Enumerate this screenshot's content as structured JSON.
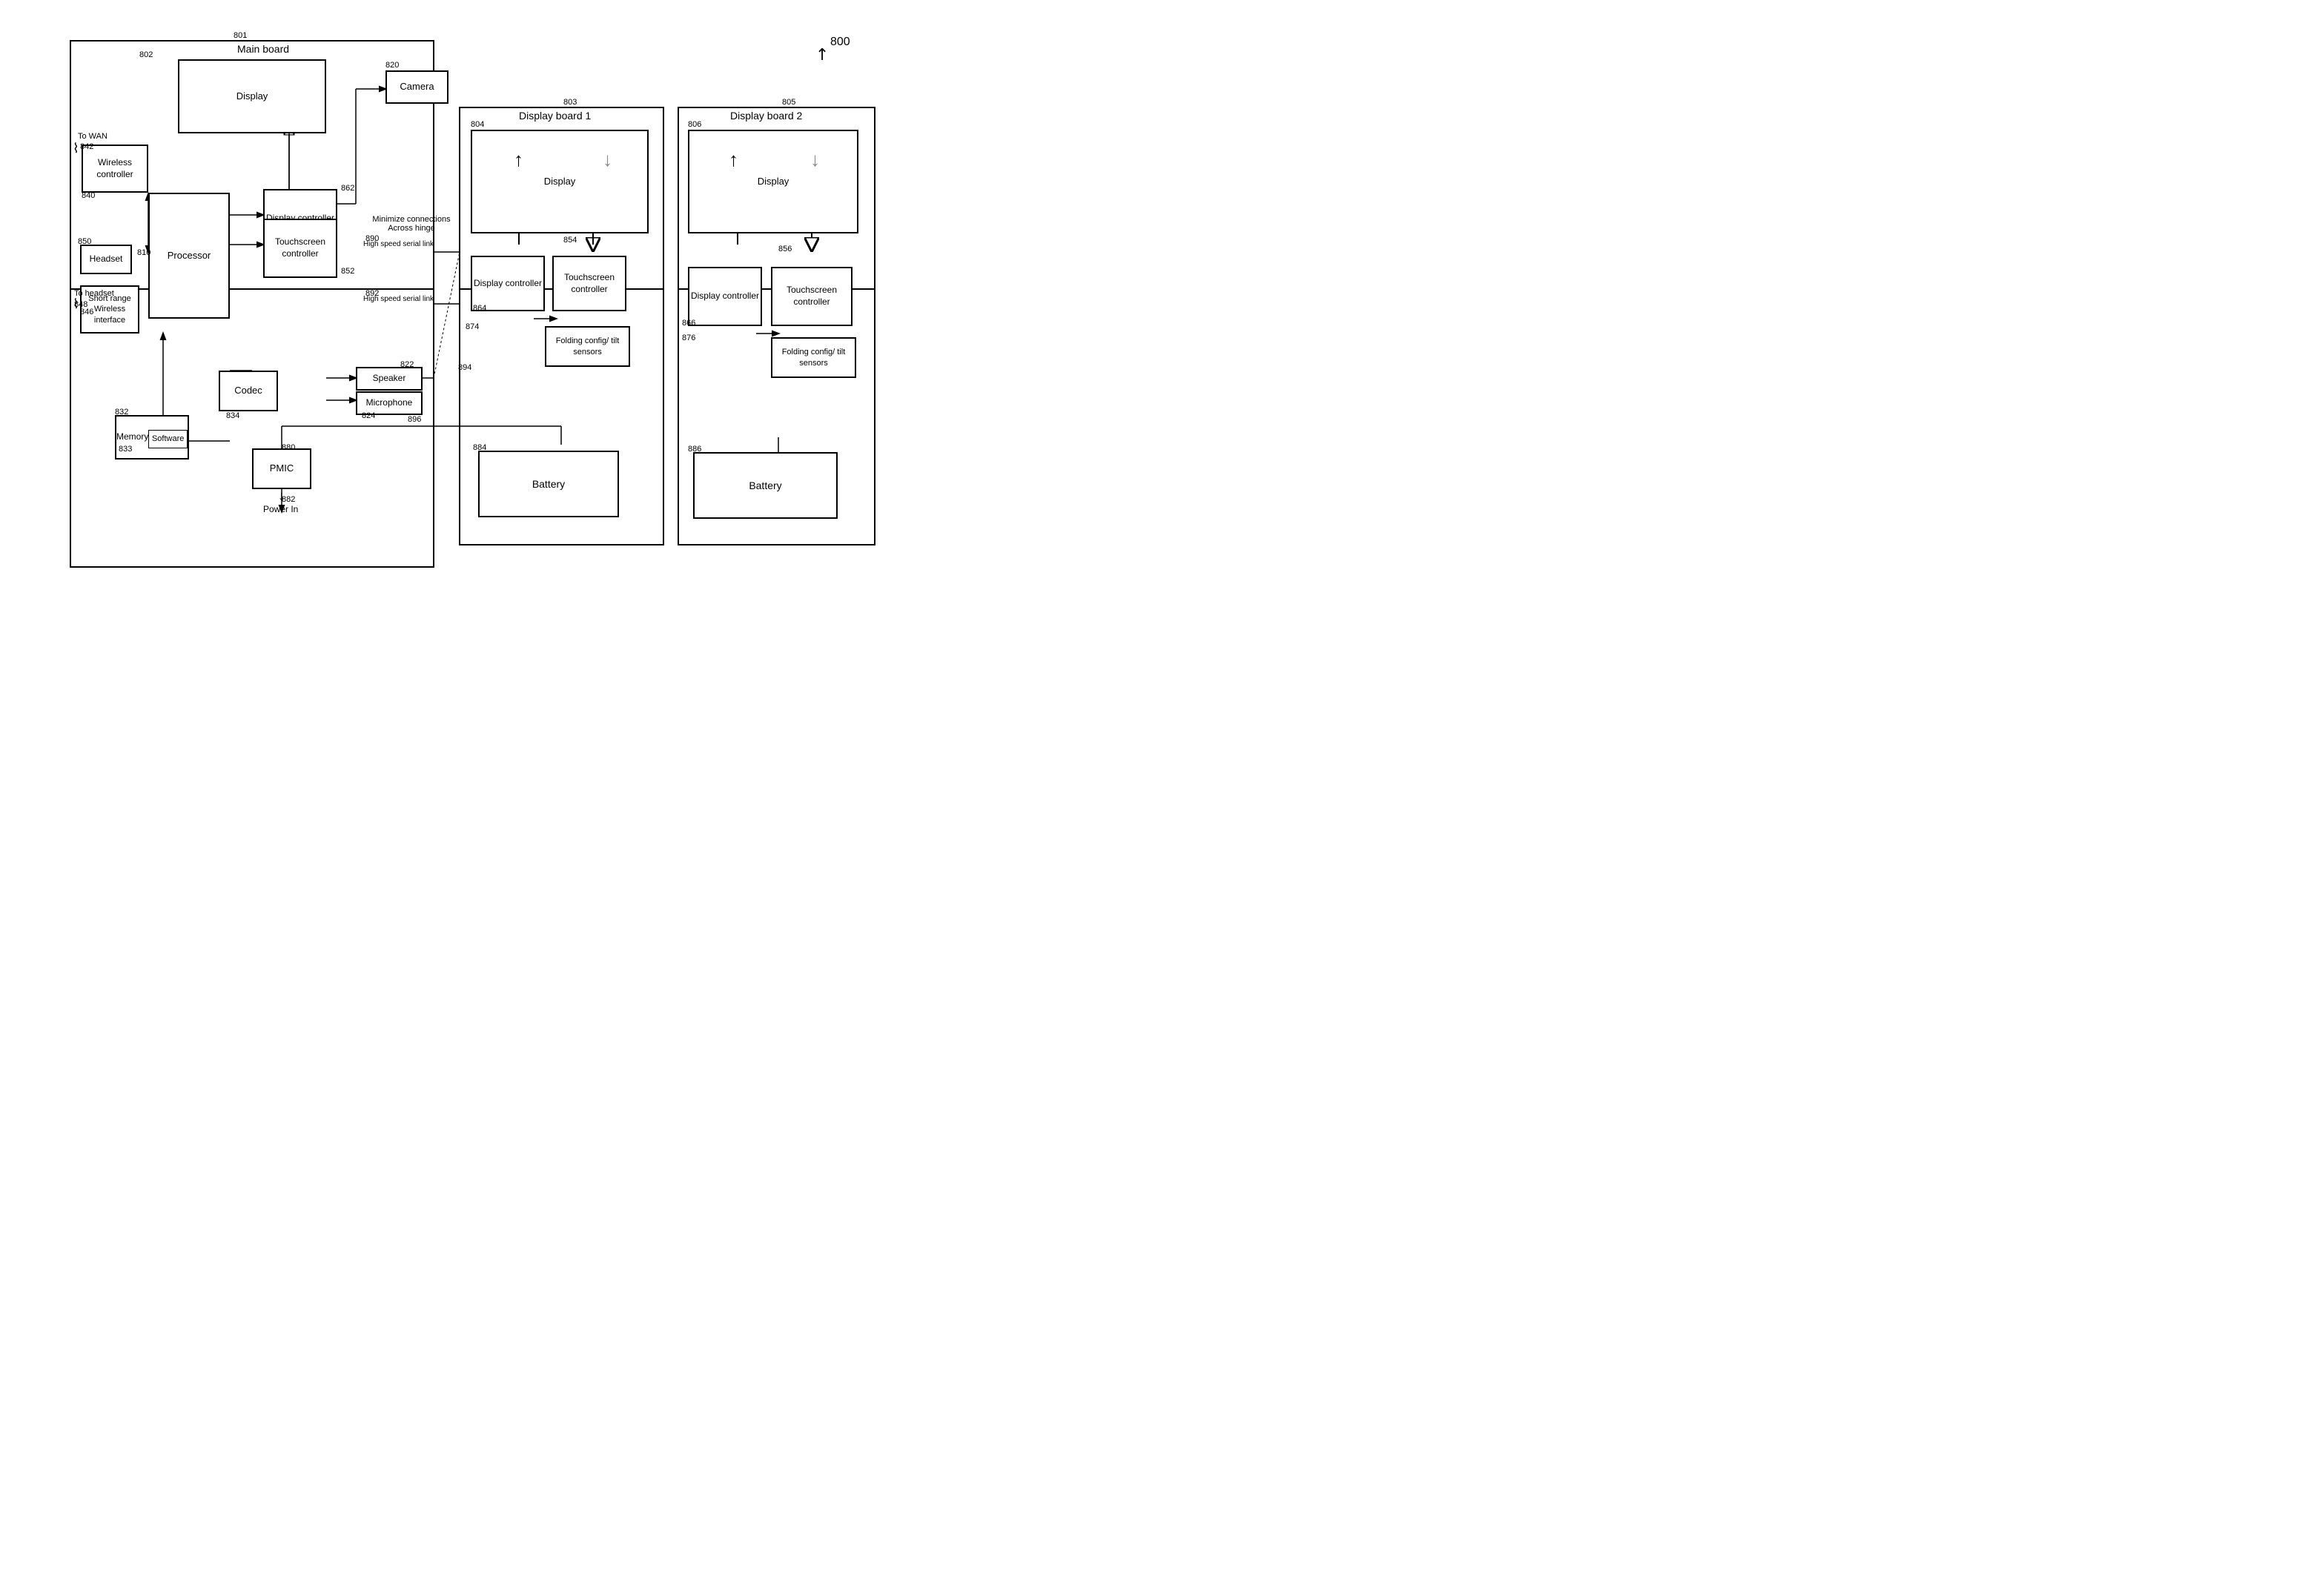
{
  "diagram": {
    "title": "800",
    "ref800": "800",
    "mainBoard": {
      "label": "Main board",
      "ref": "801",
      "display": {
        "label": "Display",
        "ref": "802"
      },
      "displayController": {
        "label": "Display controller",
        "ref": "862"
      },
      "touchscreenController": {
        "label": "Touchscreen controller",
        "ref": "852"
      },
      "processor": {
        "label": "Processor",
        "ref": "810"
      },
      "wirelessController": {
        "label": "Wireless controller",
        "ref": "840"
      },
      "shortRangeWireless": {
        "label": "Short range Wireless interface",
        "ref": "846"
      },
      "headset": {
        "label": "Headset",
        "ref": "850"
      },
      "toWAN": {
        "label": "To WAN",
        "ref": "842"
      },
      "toHeadset": {
        "label": "To headset",
        "ref": "848"
      },
      "memory": {
        "label": "Memory",
        "ref": "832"
      },
      "software": {
        "label": "Software",
        "ref": "833"
      },
      "codec": {
        "label": "Codec",
        "ref": "834"
      },
      "pmic": {
        "label": "PMIC",
        "ref": "880"
      },
      "camera": {
        "label": "Camera",
        "ref": "820"
      },
      "speaker": {
        "label": "Speaker",
        "ref": "822"
      },
      "microphone": {
        "label": "Microphone",
        "ref": "824"
      }
    },
    "displayBoard1": {
      "label": "Display board 1",
      "ref": "803",
      "display": {
        "label": "Display",
        "ref": "804"
      },
      "displayController": {
        "label": "Display controller",
        "ref": "864"
      },
      "touchscreenController": {
        "label": "Touchscreen controller",
        "ref": "854"
      },
      "foldingConfig": {
        "label": "Folding config/ tilt sensors",
        "ref": "874"
      }
    },
    "displayBoard2": {
      "label": "Display board 2",
      "ref": "805",
      "display": {
        "label": "Display",
        "ref": "806"
      },
      "displayController": {
        "label": "Display controller",
        "ref": "866"
      },
      "touchscreenController": {
        "label": "Touchscreen controller",
        "ref": "856"
      },
      "foldingConfig": {
        "label": "Folding config/ tilt sensors",
        "ref": "876"
      }
    },
    "battery1": {
      "label": "Battery",
      "ref": "884"
    },
    "battery2": {
      "label": "Battery",
      "ref": "886"
    },
    "powerIn": {
      "label": "Power In",
      "ref": "882"
    },
    "annotations": {
      "minimizeConnections": "Minimize connections\nAcross hinge",
      "highSpeedSerial1": "High speed serial link",
      "highSpeedSerial2": "High speed serial link",
      "ref890": "890",
      "ref892": "892",
      "ref894": "894",
      "ref896": "896"
    }
  }
}
